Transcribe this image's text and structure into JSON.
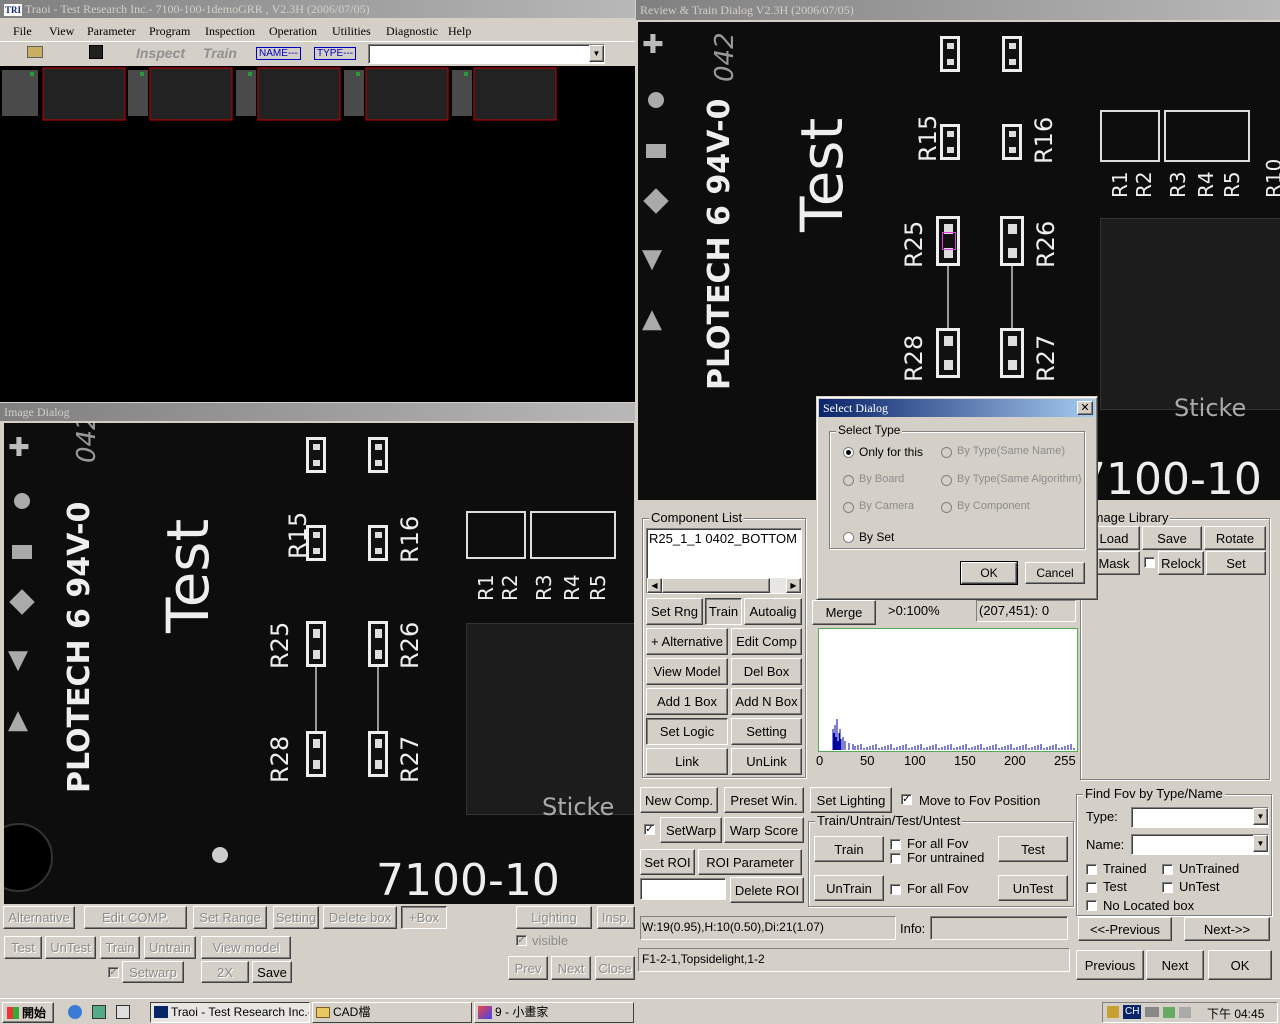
{
  "main_window": {
    "title": "Traoi - Test Research Inc.- 7100-100-1demoGRR , V2.3H (2006/07/05)",
    "menu": [
      "File",
      "View",
      "Parameter",
      "Program",
      "Inspection",
      "Operation",
      "Utilities",
      "Diagnostic",
      "Help"
    ],
    "toolbar": {
      "inspect_label": "Inspect",
      "train_label": "Train",
      "name_tag": "NAME---",
      "type_tag": "TYPE---"
    }
  },
  "image_dialog": {
    "title": "Image Dialog",
    "buttons_row1": [
      "Alternative",
      "Edit COMP.",
      "Set Range",
      "Setting",
      "Delete box",
      "+Box"
    ],
    "buttons_row2": [
      "Test",
      "UnTest",
      "Train",
      "Untrain",
      "View model"
    ],
    "buttons_row3": {
      "setwarp": "Setwarp",
      "zoom": "2X",
      "save": "Save"
    },
    "right_buttons": {
      "lighting": "Lighting",
      "insp": "Insp.",
      "visible": "visible",
      "prev": "Prev",
      "next": "Next",
      "close": "Close"
    }
  },
  "pcb_labels": {
    "board_text": "Test",
    "vertical_text": "PLOTECH 6 94V-0",
    "corner_text": "042",
    "sticker": "Sticke",
    "part_no": "7100-10",
    "r15": "R15",
    "r16": "R16",
    "r25": "R25",
    "r26": "R26",
    "r27": "R27",
    "r28": "R28",
    "r1": "R1",
    "r2": "R2",
    "r3": "R3",
    "r4": "R4",
    "r5": "R5",
    "r10": "R10"
  },
  "review_dialog": {
    "title": "Review & Train Dialog V2.3H (2006/07/05)",
    "component_list_caption": "Component List",
    "component_item": "R25_1_1 0402_BOTTOM",
    "left_buttons": [
      "Set Rng",
      "Train",
      "Autoalig",
      "+ Alternative",
      "Edit Comp",
      "View Model",
      "Del Box",
      "Add 1 Box",
      "Add N Box",
      "Set Logic",
      "Setting",
      "Link",
      "UnLink"
    ],
    "merge_label": "Merge",
    "percent_readout": ">0:100%",
    "coord_readout": "(207,451):  0",
    "histogram_ticks": [
      "0",
      "50",
      "100",
      "150",
      "200",
      "255"
    ],
    "image_library_caption": "Image Library",
    "library_buttons": {
      "load": "Load",
      "save": "Save",
      "rotate": "Rotate",
      "mask": "Mask",
      "relock": "Relock",
      "set": "Set"
    },
    "new_comp": "New Comp.",
    "preset_win": "Preset Win.",
    "set_lighting": "Set Lighting",
    "move_to_fov": "Move to Fov Position",
    "setwarp": "SetWarp",
    "warp_score": "Warp Score",
    "set_roi": "Set ROI",
    "roi_parameter": "ROI Parameter",
    "delete_roi": "Delete ROI",
    "train_group_caption": "Train/Untrain/Test/Untest",
    "train_btn": "Train",
    "for_all_fov": "For all Fov",
    "for_untrained": "For untrained",
    "test_btn": "Test",
    "untrain_btn": "UnTrain",
    "for_all_fov2": "For all Fov",
    "untest_btn": "UnTest",
    "status_wh": "W:19(0.95),H:10(0.50),Di:21(1.07)",
    "info_label": "Info:",
    "fov_info": "F1-2-1,Topsidelight,1-2",
    "find_fov_caption": "Find Fov by Type/Name",
    "type_label": "Type:",
    "name_label": "Name:",
    "trained": "Trained",
    "untrained": "UnTrained",
    "test": "Test",
    "untest": "UnTest",
    "no_located_box": "No Located box",
    "prev_btn": "<<-Previous",
    "next_btn": "Next->>",
    "previous": "Previous",
    "next": "Next",
    "ok": "OK"
  },
  "select_dialog": {
    "title": "Select Dialog",
    "group_caption": "Select Type",
    "options": [
      "Only for this",
      "By Type(Same Name)",
      "By Board",
      "By Type(Same Algorithm)",
      "By Camera",
      "By Component",
      "By Set"
    ],
    "ok": "OK",
    "cancel": "Cancel"
  },
  "taskbar": {
    "start": "開始",
    "tasks": [
      "Traoi - Test Research Inc.- ...",
      "CAD檔",
      "9 - 小畫家"
    ],
    "lang": "CH",
    "clock": "下午 04:45"
  }
}
